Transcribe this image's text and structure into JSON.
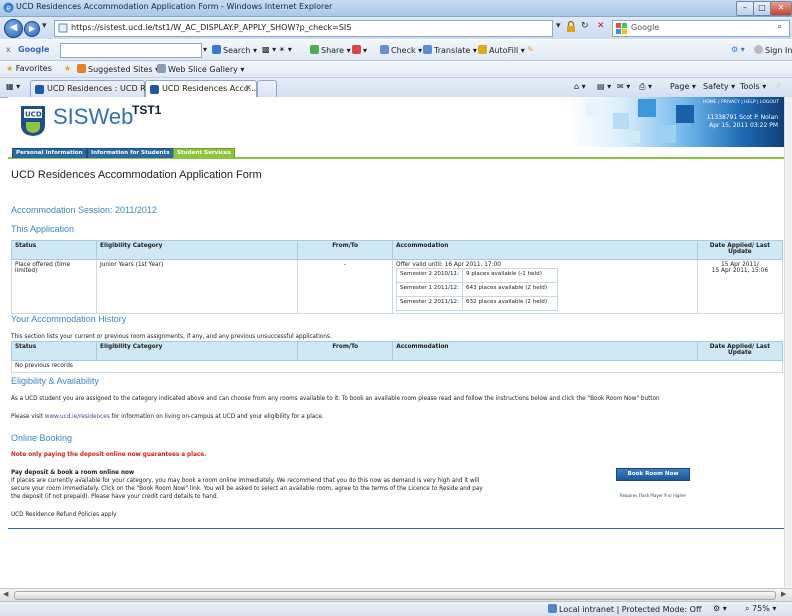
{
  "window": {
    "title": "UCD Residences Accommodation Application Form - Windows Internet Explorer",
    "minimize": "–",
    "maximize": "□",
    "close": "✕"
  },
  "address_bar": {
    "url": "https://sistest.ucd.ie/tst1/W_AC_DISPLAY.P_APPLY_SHOW?p_check=SIS",
    "search_engine": "Google"
  },
  "google_toolbar": {
    "close": "x",
    "label": "Google",
    "search": "Search",
    "share": "Share",
    "check": "Check",
    "translate": "Translate",
    "autofill": "AutoFill",
    "sign_in": "Sign In"
  },
  "favorites_bar": {
    "favorites": "Favorites",
    "suggested_sites": "Suggested Sites ▾",
    "web_slice_gallery": "Web Slice Gallery ▾"
  },
  "tabs": [
    {
      "label": "UCD Residences : UCD Res..."
    },
    {
      "label": "UCD Residences Acco..."
    }
  ],
  "command_bar": {
    "page": "Page ▾",
    "safety": "Safety ▾",
    "tools": "Tools ▾"
  },
  "site": {
    "logo_text": "SISWeb",
    "env": "TST1",
    "top_links": "HOME | PRIVACY | HELP | LOGOUT",
    "user_line1": "11338791 Scot P. Nolan",
    "user_line2": "Apr 15, 2011 03:22 PM",
    "nav_tabs": [
      "Personal Information",
      "Information for Students",
      "Student Services"
    ]
  },
  "form": {
    "title": "UCD Residences Accommodation Application Form",
    "session": "Accommodation Session: 2011/2012",
    "this_application": {
      "heading": "This Application",
      "columns": [
        "Status",
        "Eligibility Category",
        "From/To",
        "Accommodation",
        "Date Applied/ Last Update"
      ],
      "row": {
        "status": "Place offered (time limited)",
        "eligibility": "Junior Years (1st Year)",
        "from_to": "-",
        "offer": "Offer valid until: 16 Apr 2011, 17:00",
        "options": [
          {
            "semester": "Semester 2 2010/11:",
            "places": "9 places available (-1 held)"
          },
          {
            "semester": "Semester 1 2011/12:",
            "places": "643 places available (2 held)"
          },
          {
            "semester": "Semester 2 2011/12:",
            "places": "632 places available (2 held)"
          }
        ],
        "date_applied": "15 Apr 2011/",
        "last_update": "15 Apr 2011, 15:06"
      }
    },
    "history": {
      "heading": "Your Accommodation History",
      "intro": "This section lists your current or previous room assignments, if any, and any previous unsuccessful applications.",
      "columns": [
        "Status",
        "Eligibility Category",
        "From/To",
        "Accommodation",
        "Date Applied/ Last Update"
      ],
      "empty": "No previous records"
    },
    "eligibility": {
      "heading": "Eligibility & Availability",
      "text1": "As a UCD student you are assigned to the category indicated above and can choose from any rooms available to it. To book an available room please read and follow the instructions below and click the \"Book Room Now\" button",
      "text2_pre": "Please visit ",
      "text2_link": "www.ucd.ie/residences",
      "text2_post": " for information on living on-campus at UCD and your eligibility for a place."
    },
    "booking": {
      "heading": "Online Booking",
      "warning": "Note only paying the deposit online now guarantees a place.",
      "subheading": "Pay deposit & book a room online now",
      "lines": [
        "If places are currently available for your category, you may book a room online immediately. We recommend that you do this now as demand is very high and it will",
        "secure your room immediately. Click on the \"Book Room Now\" link. You will be asked to select an available room, agree to the terms of the Licence to Reside and pay",
        "the deposit (if not prepaid). Please have your credit card details to hand."
      ],
      "button": "Book Room Now",
      "requires": "Requires Flash Player 9 or higher",
      "refund": "UCD Residence Refund Policies apply"
    }
  },
  "status_bar": {
    "zone": "Local intranet | Protected Mode: Off",
    "zoom": "75%"
  }
}
